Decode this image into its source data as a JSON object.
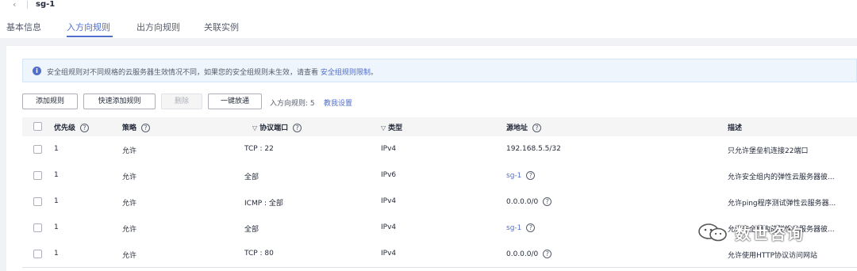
{
  "header": {
    "back_icon": "chevron-left-icon",
    "title": "sg-1"
  },
  "tabs": [
    {
      "label": "基本信息",
      "active": false
    },
    {
      "label": "入方向规则",
      "active": true
    },
    {
      "label": "出方向规则",
      "active": false
    },
    {
      "label": "关联实例",
      "active": false
    }
  ],
  "notice": {
    "icon": "info-icon",
    "text": "安全组规则对不同规格的云服务器生效情况不同，如果您的安全组规则未生效，请查看",
    "link": "安全组规则限制",
    "suffix": "。"
  },
  "toolbar": {
    "add": "添加规则",
    "quick_add": "快速添加规则",
    "delete": "删除",
    "one_click": "一键放通",
    "count_text": "入方向规则: 5",
    "tutorial_link": "教我设置"
  },
  "table": {
    "headers": {
      "priority": "优先级",
      "policy": "策略",
      "protocol_port": "协议端口",
      "type": "类型",
      "source": "源地址",
      "description": "描述"
    },
    "rows": [
      {
        "priority": "1",
        "policy": "允许",
        "protocol_port": "TCP : 22",
        "type": "IPv4",
        "source": "192.168.5.5/32",
        "source_is_link": false,
        "source_help": false,
        "description": "只允许堡垒机连接22端口"
      },
      {
        "priority": "1",
        "policy": "允许",
        "protocol_port": "全部",
        "type": "IPv6",
        "source": "sg-1",
        "source_is_link": true,
        "source_help": true,
        "description": "允许安全组内的弹性云服务器彼..."
      },
      {
        "priority": "1",
        "policy": "允许",
        "protocol_port": "ICMP : 全部",
        "type": "IPv4",
        "source": "0.0.0.0/0",
        "source_is_link": false,
        "source_help": true,
        "description": "允许ping程序测试弹性云服务器..."
      },
      {
        "priority": "1",
        "policy": "允许",
        "protocol_port": "全部",
        "type": "IPv4",
        "source": "sg-1",
        "source_is_link": true,
        "source_help": true,
        "description": "允许安全组内的弹性云服务器彼..."
      },
      {
        "priority": "1",
        "policy": "允许",
        "protocol_port": "TCP : 80",
        "type": "IPv4",
        "source": "0.0.0.0/0",
        "source_is_link": false,
        "source_help": true,
        "description": "允许使用HTTP协议访问网站"
      }
    ]
  },
  "watermark": {
    "text": "数世咨询",
    "icon": "wechat-logo-icon"
  }
}
